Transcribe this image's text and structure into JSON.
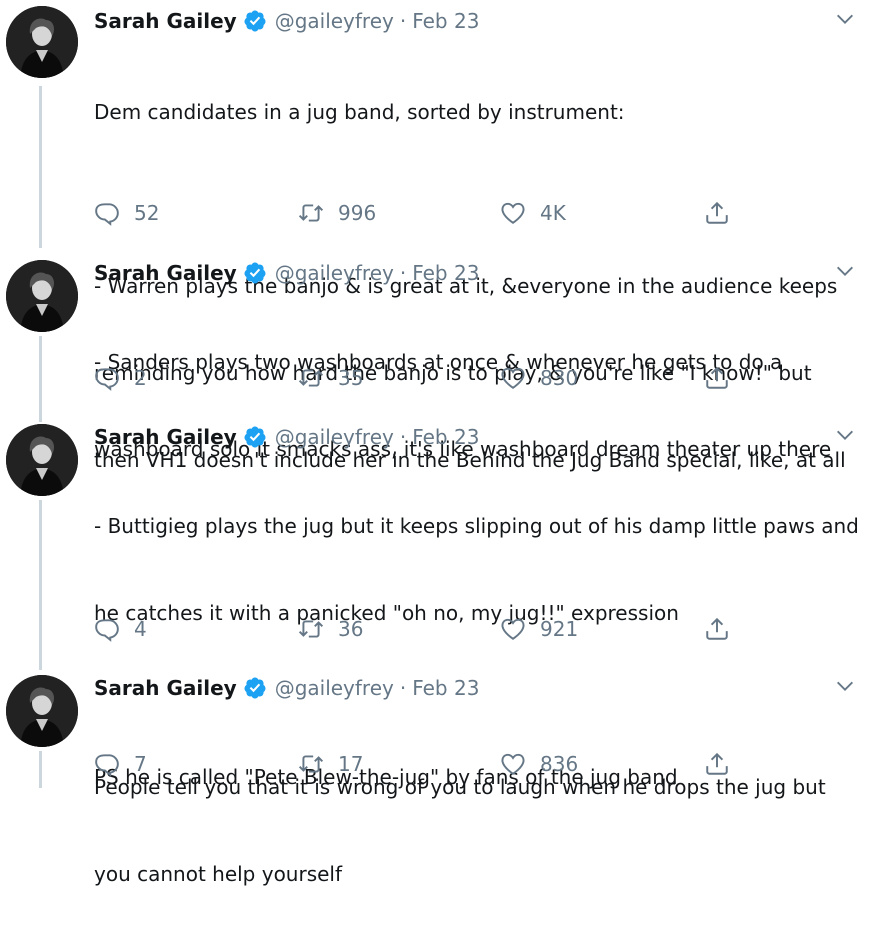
{
  "colors": {
    "text": "#14171a",
    "secondary": "#657786",
    "verified": "#1da1f2",
    "thread_line": "#ccd6dd"
  },
  "tweets": [
    {
      "name": "Sarah Gailey",
      "handle": "@gaileyfrey",
      "separator": "·",
      "date": "Feb 23",
      "lines": [
        "Dem candidates in a jug band, sorted by instrument:",
        "",
        "- Warren plays the banjo & is great at it, &everyone in the audience keeps",
        "reminding you how hard the banjo is to play, & you're like \"I know!\" but",
        "then VH1 doesn't include her in the Behind the Jug Band special, like, at all"
      ],
      "replies": "52",
      "retweets": "996",
      "likes": "4K"
    },
    {
      "name": "Sarah Gailey",
      "handle": "@gaileyfrey",
      "separator": "·",
      "date": "Feb 23",
      "lines": [
        "- Sanders plays two washboards at once & whenever he gets to do a",
        "washboard solo it smacks ass, it's like washboard dream theater up there"
      ],
      "replies": "2",
      "retweets": "35",
      "likes": "830"
    },
    {
      "name": "Sarah Gailey",
      "handle": "@gaileyfrey",
      "separator": "·",
      "date": "Feb 23",
      "lines": [
        "- Buttigieg plays the jug but it keeps slipping out of his damp little paws and",
        "he catches it with a panicked \"oh no, my jug!!\" expression",
        "",
        "People tell you that it is wrong of you to laugh when he drops the jug but",
        "you cannot help yourself"
      ],
      "replies": "4",
      "retweets": "36",
      "likes": "921"
    },
    {
      "name": "Sarah Gailey",
      "handle": "@gaileyfrey",
      "separator": "·",
      "date": "Feb 23",
      "lines": [
        "PS he is called \"Pete Blew-the-jug\" by fans of the jug band"
      ],
      "replies": "7",
      "retweets": "17",
      "likes": "836"
    }
  ],
  "icons": {
    "reply": "reply-icon",
    "retweet": "retweet-icon",
    "like": "heart-icon",
    "share": "share-icon",
    "more": "chevron-down-icon",
    "verified": "verified-badge-icon"
  }
}
